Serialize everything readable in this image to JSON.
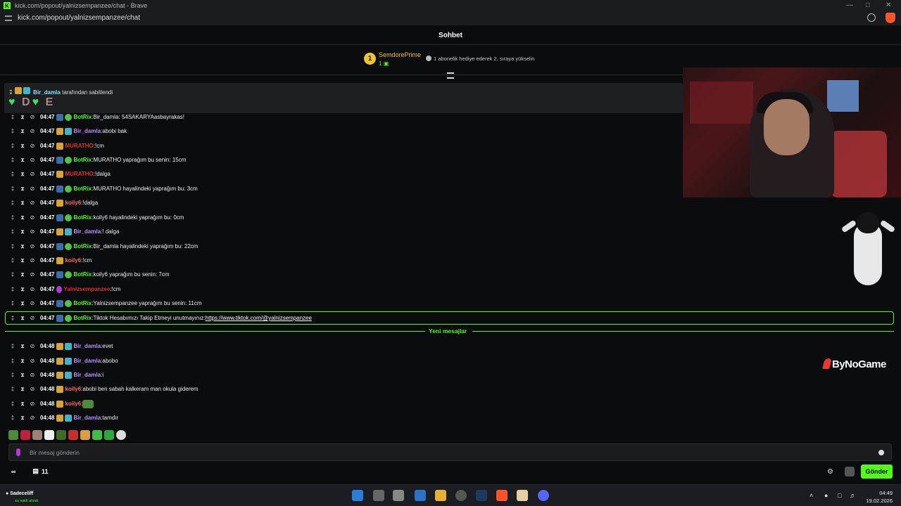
{
  "browser": {
    "tab_title": "kick.com/popout/yalnizsempanzee/chat - Brave",
    "url": "kick.com/popout/yalnizsempanzee/chat"
  },
  "chat": {
    "header": "Sohbet",
    "top_gifter": {
      "rank": "1",
      "name": "SemdorePrime",
      "count": "1",
      "promo": "1 abonelik hediye ederek 2. sıraya yükselin"
    },
    "pinned": {
      "by_user": "Bir_damla",
      "by_text": "tarafından sabitlendi",
      "emote_letters": [
        "D",
        "E"
      ]
    },
    "messages": [
      {
        "time": "04:47",
        "user": "BotRix",
        "sep": ": ",
        "text": "Bir_damla: 54SAKARYAasbayrakas!"
      },
      {
        "time": "04:47",
        "user": "Bir_damla",
        "sep": ": ",
        "text": "abobi bak"
      },
      {
        "time": "04:47",
        "user": "MURATHO",
        "sep": ": ",
        "text": "!cm"
      },
      {
        "time": "04:47",
        "user": "BotRix",
        "sep": ": ",
        "text": "MURATHO yaprağım bu senin: 15cm"
      },
      {
        "time": "04:47",
        "user": "MURATHO",
        "sep": ": ",
        "text": "!dalga"
      },
      {
        "time": "04:47",
        "user": "BotRix",
        "sep": ": ",
        "text": "MURATHO hayalindeki yaprağım bu: 3cm"
      },
      {
        "time": "04:47",
        "user": "koily6",
        "sep": ": ",
        "text": "!dalga"
      },
      {
        "time": "04:47",
        "user": "BotRix",
        "sep": ": ",
        "text": "koily6 hayalindeki yaprağım bu: 0cm"
      },
      {
        "time": "04:47",
        "user": "Bir_damla",
        "sep": ": ",
        "text": "! dalga"
      },
      {
        "time": "04:47",
        "user": "BotRix",
        "sep": ": ",
        "text": "Bir_damla hayalindeki yaprağım bu: 22cm"
      },
      {
        "time": "04:47",
        "user": "koily6",
        "sep": ": ",
        "text": "!cm"
      },
      {
        "time": "04:47",
        "user": "BotRix",
        "sep": ": ",
        "text": "koily6 yaprağım bu senin: 7cm"
      },
      {
        "time": "04:47",
        "user": "Yalnizsempanzee",
        "sep": ": ",
        "text": "!cm"
      },
      {
        "time": "04:47",
        "user": "BotRix",
        "sep": ": ",
        "text": "Yalnizsempanzee yaprağım bu senin: 11cm"
      },
      {
        "time": "04:47",
        "user": "BotRix",
        "sep": ": ",
        "text": "Tiktok Hesabımızı Takip Etmeyi unutmayınız: ",
        "link": "https://www.tiktok.com/@yalnizsempanzee"
      }
    ],
    "new_messages_label": "Yeni mesajlar",
    "new_messages": [
      {
        "time": "04:48",
        "user": "Bir_damla",
        "sep": ": ",
        "text": "evet"
      },
      {
        "time": "04:48",
        "user": "Bir_damla",
        "sep": ": ",
        "text": "abobo"
      },
      {
        "time": "04:48",
        "user": "Bir_damla",
        "sep": ": ",
        "text": "i"
      },
      {
        "time": "04:48",
        "user": "koily6",
        "sep": ": ",
        "text": "abobi ben sabah kalkeram man okula giderem"
      },
      {
        "time": "04:48",
        "user": "koily6",
        "sep": ": ",
        "text": ""
      },
      {
        "time": "04:48",
        "user": "Bir_damla",
        "sep": ": ",
        "text": "tamdır"
      }
    ],
    "input_placeholder": "Bir mesaj gönderin",
    "points": "11",
    "send_label": "Gönder"
  },
  "overlay": {
    "brand": "ByNoGame"
  },
  "taskbar": {
    "user": "Sadeceliff",
    "user_sub": "su vakti alındı",
    "time": "04:49",
    "date": "19.02.2026"
  },
  "colors": {
    "accent": "#53fc18",
    "botrix": "#53fc18",
    "bir_damla": "#b991ff",
    "muratho": "#e0312c",
    "koily6": "#ff6b6b",
    "gifter": "#f1c232"
  }
}
